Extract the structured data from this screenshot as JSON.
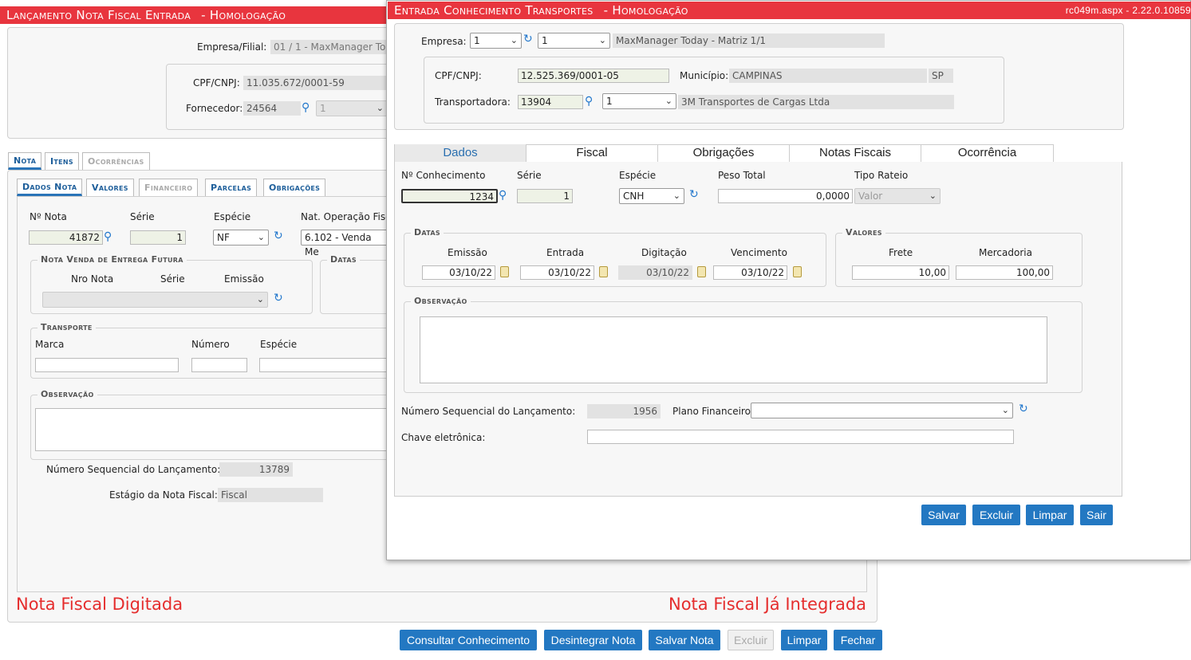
{
  "main": {
    "title": "Lançamento Nota Fiscal Entrada",
    "env": "- Homologação",
    "empresa_label": "Empresa/Filial:",
    "empresa_value": "01 / 1 - MaxManager To",
    "cpf_label": "CPF/CNPJ:",
    "cpf_value": "11.035.672/0001-59",
    "fornecedor_label": "Fornecedor:",
    "fornecedor_code": "24564",
    "fornecedor_sel": "1",
    "tabs_top": [
      "Nota",
      "Itens",
      "Ocorrências"
    ],
    "tabs_sub": [
      "Dados Nota",
      "Valores",
      "Financeiro",
      "Parcelas",
      "Obrigações"
    ],
    "nota_label": "Nº Nota",
    "nota_value": "41872",
    "serie_label": "Série",
    "serie_value": "1",
    "especie_label": "Espécie",
    "especie_value": "NF",
    "natop_label": "Nat. Operação Fisc",
    "natop_value": "6.102 - Venda Me",
    "venda_legend": "Nota Venda de Entrega Futura",
    "nro_nota_label": "Nro Nota",
    "venda_serie_label": "Série",
    "venda_emissao_label": "Emissão",
    "datas_legend": "Datas",
    "transporte_legend": "Transporte",
    "marca_label": "Marca",
    "numero_label": "Número",
    "trans_especie_label": "Espécie",
    "obs_legend": "Observação",
    "seq_label": "Número Sequencial do Lançamento:",
    "seq_value": "13789",
    "estagio_label": "Estágio da Nota Fiscal:",
    "estagio_value": "Fiscal",
    "status_left": "Nota Fiscal Digitada",
    "status_right": "Nota Fiscal Já Integrada",
    "buttons": [
      "Consultar Conhecimento",
      "Desintegrar Nota",
      "Salvar Nota",
      "Excluir",
      "Limpar",
      "Fechar"
    ]
  },
  "modal": {
    "title": "Entrada Conhecimento Transportes",
    "env": "- Homologação",
    "version": "rc049m.aspx - 2.22.0.10859",
    "empresa_label": "Empresa:",
    "empresa_sel": "1",
    "filial_sel": "1",
    "empresa_name": "MaxManager Today - Matriz 1/1",
    "cpf_label": "CPF/CNPJ:",
    "cpf_value": "12.525.369/0001-05",
    "municipio_label": "Município:",
    "municipio_value": "CAMPINAS",
    "uf": "SP",
    "transp_label": "Transportadora:",
    "transp_code": "13904",
    "transp_sel": "1",
    "transp_name": "3M Transportes de Cargas Ltda",
    "tabs": [
      "Dados",
      "Fiscal",
      "Obrigações",
      "Notas Fiscais",
      "Ocorrência"
    ],
    "conhec_label": "Nº Conhecimento",
    "conhec_value": "1234",
    "serie_label": "Série",
    "serie_value": "1",
    "especie_label": "Espécie",
    "especie_value": "CNH",
    "peso_label": "Peso Total",
    "peso_value": "0,0000",
    "rateio_label": "Tipo Rateio",
    "rateio_value": "Valor",
    "datas_legend": "Datas",
    "emissao_label": "Emissão",
    "emissao_value": "03/10/22",
    "entrada_label": "Entrada",
    "entrada_value": "03/10/22",
    "digitacao_label": "Digitação",
    "digitacao_value": "03/10/22",
    "venc_label": "Vencimento",
    "venc_value": "03/10/22",
    "valores_legend": "Valores",
    "frete_label": "Frete",
    "frete_value": "10,00",
    "merc_label": "Mercadoria",
    "merc_value": "100,00",
    "obs_legend": "Observação",
    "seq_label": "Número Sequencial do Lançamento:",
    "seq_value": "1956",
    "plano_label": "Plano Financeiro",
    "chave_label": "Chave eletrônica:",
    "buttons": [
      "Salvar",
      "Excluir",
      "Limpar",
      "Sair"
    ]
  },
  "colors": {
    "accent": "#e8353e",
    "button": "#2378c2",
    "status_red": "#e52d2d"
  }
}
